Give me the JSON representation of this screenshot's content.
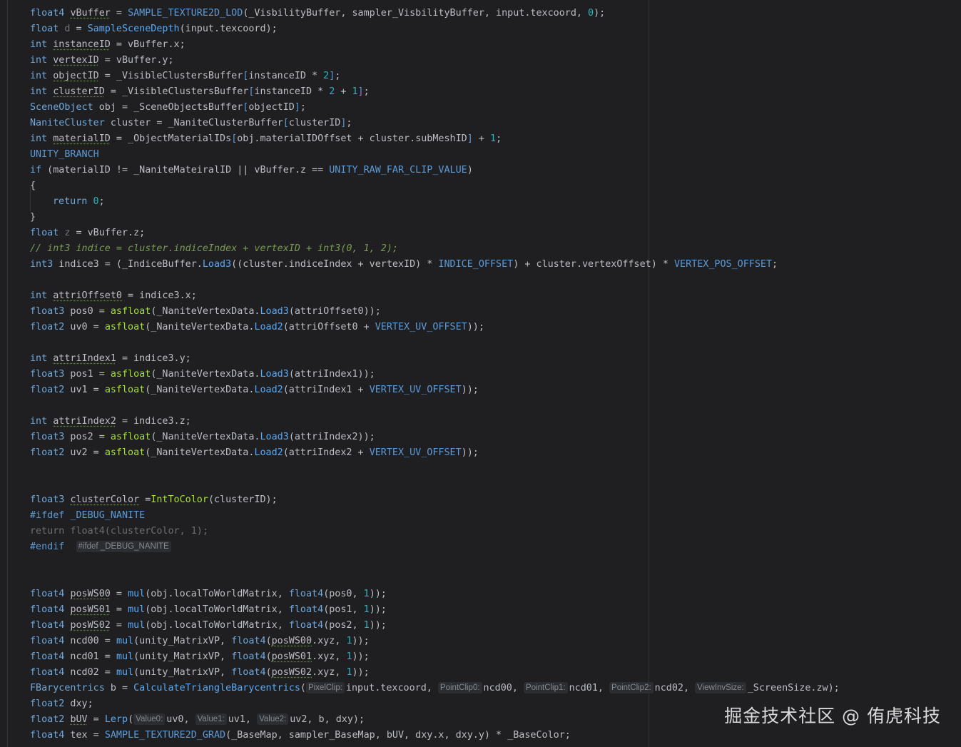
{
  "watermark": "掘金技术社区 @ 侑虎科技",
  "endif_hint": "#ifdef _DEBUG_NANITE",
  "hints": {
    "pixel_clip": "PixelClip:",
    "point_clip0": "PointClip0:",
    "point_clip1": "PointClip1:",
    "point_clip2": "PointClip2:",
    "view_inv_size": "ViewInvSize:",
    "value0": "Value0:",
    "value1": "Value1:",
    "value2": "Value2:"
  },
  "code_lines": [
    "float4 vBuffer = SAMPLE_TEXTURE2D_LOD(_VisbilityBuffer, sampler_VisbilityBuffer, input.texcoord, 0);",
    "float d = SampleSceneDepth(input.texcoord);",
    "int instanceID = vBuffer.x;",
    "int vertexID = vBuffer.y;",
    "int objectID = _VisibleClustersBuffer[instanceID * 2];",
    "int clusterID = _VisibleClustersBuffer[instanceID * 2 + 1];",
    "SceneObject obj = _SceneObjectsBuffer[objectID];",
    "NaniteCluster cluster = _NaniteClusterBuffer[clusterID];",
    "int materialID = _ObjectMaterialIDs[obj.materialIDOffset + cluster.subMeshID] + 1;",
    "UNITY_BRANCH",
    "if (materialID != _NaniteMateiralID || vBuffer.z == UNITY_RAW_FAR_CLIP_VALUE)",
    "{",
    "return 0;",
    "}",
    "float z = vBuffer.z;",
    "// int3 indice = cluster.indiceIndex + vertexID + int3(0, 1, 2);",
    "int3 indice3 = (_IndiceBuffer.Load3((cluster.indiceIndex + vertexID) * INDICE_OFFSET) + cluster.vertexOffset) * VERTEX_POS_OFFSET;",
    "",
    "int attriOffset0 = indice3.x;",
    "float3 pos0 = asfloat(_NaniteVertexData.Load3(attriOffset0));",
    "float2 uv0 = asfloat(_NaniteVertexData.Load2(attriOffset0 + VERTEX_UV_OFFSET));",
    "",
    "int attriIndex1 = indice3.y;",
    "float3 pos1 = asfloat(_NaniteVertexData.Load3(attriIndex1));",
    "float2 uv1 = asfloat(_NaniteVertexData.Load2(attriIndex1 + VERTEX_UV_OFFSET));",
    "",
    "int attriIndex2 = indice3.z;",
    "float3 pos2 = asfloat(_NaniteVertexData.Load3(attriIndex2));",
    "float2 uv2 = asfloat(_NaniteVertexData.Load2(attriIndex2 + VERTEX_UV_OFFSET));",
    "",
    "",
    "float3 clusterColor =IntToColor(clusterID);",
    "#ifdef _DEBUG_NANITE",
    "return float4(clusterColor, 1);",
    "#endif",
    "",
    "",
    "float4 posWS00 = mul(obj.localToWorldMatrix, float4(pos0, 1));",
    "float4 posWS01 = mul(obj.localToWorldMatrix, float4(pos1, 1));",
    "float4 posWS02 = mul(obj.localToWorldMatrix, float4(pos2, 1));",
    "float4 ncd00 = mul(unity_MatrixVP, float4(posWS00.xyz, 1));",
    "float4 ncd01 = mul(unity_MatrixVP, float4(posWS01.xyz, 1));",
    "float4 ncd02 = mul(unity_MatrixVP, float4(posWS02.xyz, 1));",
    "FBarycentrics b = CalculateTriangleBarycentrics( input.texcoord,  ncd00,  ncd01,  ncd02,  _ScreenSize.zw);",
    "float2 dxy;",
    "float2 bUV = Lerp( uv0,  uv1,  uv2, b, dxy);",
    "float4 tex = SAMPLE_TEXTURE2D_GRAD(_BaseMap, sampler_BaseMap, bUV, dxy.x, dxy.y) * _BaseColor;"
  ]
}
